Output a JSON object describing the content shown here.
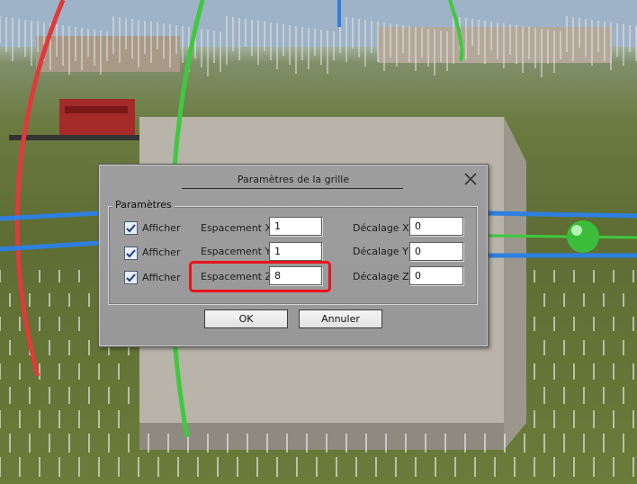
{
  "dialog": {
    "title": "Paramètres de la grille",
    "group_label": "Paramètres",
    "rows": [
      {
        "show_label": "Afficher",
        "show_checked": true,
        "spacing_label": "Espacement X",
        "spacing_value": "1",
        "offset_label": "Décalage X",
        "offset_value": "0"
      },
      {
        "show_label": "Afficher",
        "show_checked": true,
        "spacing_label": "Espacement Y",
        "spacing_value": "1",
        "offset_label": "Décalage Y",
        "offset_value": "0"
      },
      {
        "show_label": "Afficher",
        "show_checked": true,
        "spacing_label": "Espacement Z",
        "spacing_value": "8",
        "offset_label": "Décalage Z",
        "offset_value": "0"
      }
    ],
    "ok_label": "OK",
    "cancel_label": "Annuler"
  },
  "icons": {
    "close": "close-icon",
    "check": "checkmark-icon"
  },
  "colors": {
    "highlight": "#e8121b",
    "axis_red": "#e03a3a",
    "axis_green": "#3ec93e",
    "axis_blue": "#2f7fe0"
  }
}
